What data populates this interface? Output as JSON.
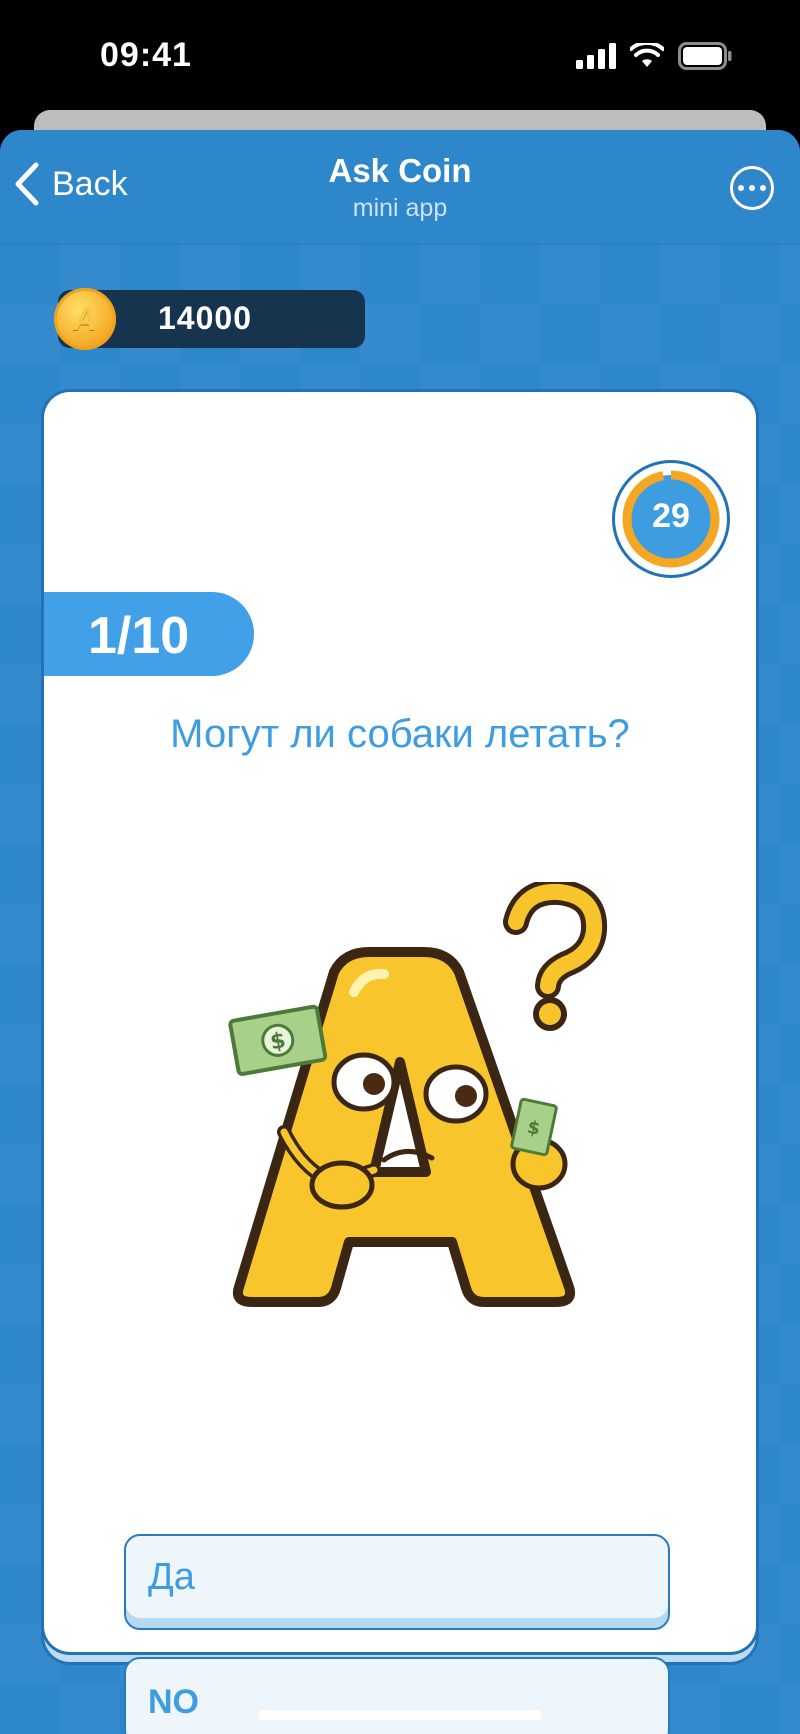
{
  "status_bar": {
    "time": "09:41"
  },
  "nav": {
    "back_label": "Back",
    "title": "Ask Coin",
    "subtitle": "mini app"
  },
  "balance": {
    "coin_letter": "A",
    "value": "14000"
  },
  "timer": {
    "value": "29",
    "progress": 0.97
  },
  "quiz": {
    "counter": "1/10",
    "question": "Могут ли собаки летать?",
    "answers": [
      "Да",
      "NO"
    ]
  },
  "colors": {
    "primary": "#2e86cb",
    "accent": "#3d9de0",
    "coin": "#f5a623",
    "balance_bg": "#17344f"
  },
  "icons": [
    "chevron-left-icon",
    "more-icon",
    "coin-icon",
    "signal-icon",
    "wifi-icon",
    "battery-icon"
  ]
}
